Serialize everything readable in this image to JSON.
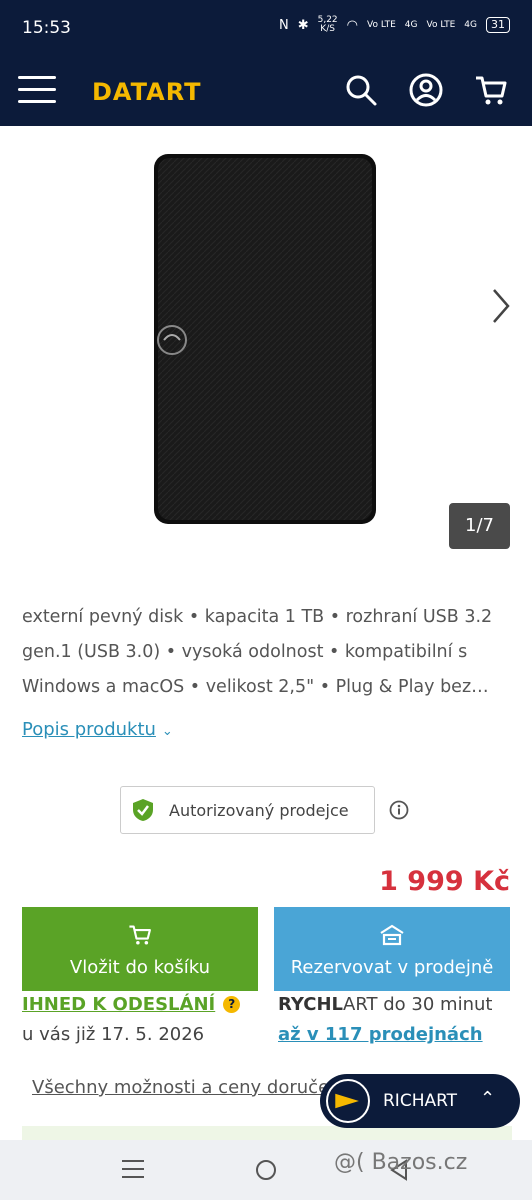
{
  "status": {
    "time": "15:53",
    "speed": "5,22",
    "speed_unit": "K/S",
    "net1": "Vo LTE",
    "net2": "4G",
    "net3": "Vo LTE",
    "net4": "4G",
    "battery": "31"
  },
  "header": {
    "logo": "DATART",
    "icons": [
      "menu-icon",
      "search-icon",
      "account-icon",
      "cart-icon"
    ]
  },
  "gallery": {
    "counter": "1/7"
  },
  "product": {
    "description": "externí pevný disk • kapacita 1 TB • rozhraní USB 3.2 gen.1 (USB 3.0) • vysoká odolnost • kompatibilní s Windows a macOS • velikost 2,5\" • Plug & Play bez…",
    "description_link": "Popis produktu",
    "authorized_label": "Autorizovaný prodejce",
    "price": "1 999 Kč"
  },
  "actions": {
    "cart_label": "Vložit do košíku",
    "reserve_label": "Rezervovat v prodejně"
  },
  "availability": {
    "status": "IHNED K ODESLÁNÍ",
    "date": "u vás již 17. 5. 2026",
    "rych_bold": "RYCHL",
    "rych_rest": "ART do 30 minut",
    "stores": "až v 117 prodejnách",
    "all_options": "Všechny možnosti a ceny doruče"
  },
  "chat": {
    "name": "RICHART"
  },
  "watermark": "@( Bazos.cz",
  "colors": {
    "brand_navy": "#0c1b3a",
    "brand_yellow": "#f5b800",
    "price_red": "#d6313d",
    "cart_green": "#5aa326",
    "reserve_blue": "#4aa5d6"
  }
}
